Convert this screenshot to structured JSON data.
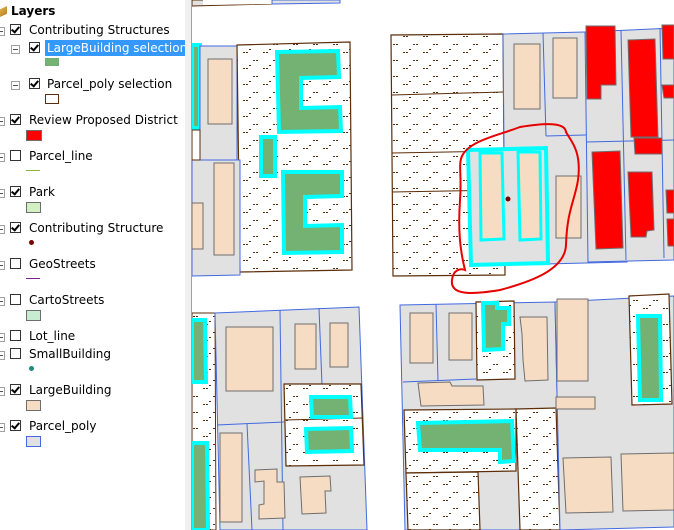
{
  "toc": {
    "title": "Layers",
    "items": [
      {
        "label": "Contributing Structures",
        "checked": true,
        "level": 0,
        "type": "group"
      },
      {
        "label": "LargeBuilding selection",
        "checked": true,
        "level": 1,
        "selected": true,
        "swatch": "green-fill"
      },
      {
        "label": "Parcel_poly selection",
        "checked": true,
        "level": 1,
        "swatch": "dotted-parcel"
      },
      {
        "label": "Review Proposed District",
        "checked": true,
        "level": 0,
        "swatch": "red-fill"
      },
      {
        "label": "Parcel_line",
        "checked": false,
        "level": 0,
        "swatch": "green-line"
      },
      {
        "label": "Park",
        "checked": true,
        "level": 0,
        "swatch": "light-green-fill"
      },
      {
        "label": "Contributing Structure",
        "checked": true,
        "level": 0,
        "swatch": "dark-red-point"
      },
      {
        "label": "GeoStreets",
        "checked": false,
        "level": 0,
        "swatch": "purple-line"
      },
      {
        "label": "CartoStreets",
        "checked": false,
        "level": 0,
        "swatch": "mint-fill"
      },
      {
        "label": "Lot_line",
        "checked": false,
        "level": 0
      },
      {
        "label": "SmallBuilding",
        "checked": false,
        "level": 0,
        "swatch": "teal-point"
      },
      {
        "label": "LargeBuilding",
        "checked": true,
        "level": 0,
        "swatch": "tan-fill"
      },
      {
        "label": "Parcel_poly",
        "checked": true,
        "level": 0,
        "swatch": "gray-fill-blue-outline"
      }
    ]
  },
  "colors": {
    "selection_highlight": "#3399ff",
    "parcel_fill": "#e1e1e1",
    "parcel_outline": "#4169e1",
    "building_fill": "#f5dcc3",
    "building_outline": "#6e6e6e",
    "district_fill": "#ff0000",
    "selected_building_fill": "#73b273",
    "selection_outline": "#00ffff",
    "selected_parcel_outline": "#5c2e0a",
    "annotation_red": "#e60000"
  },
  "map": {
    "description": "Parcel map with selected large buildings highlighted in cyan, review district buildings in red, and a hand-drawn red circle annotation around a selected parcel"
  }
}
